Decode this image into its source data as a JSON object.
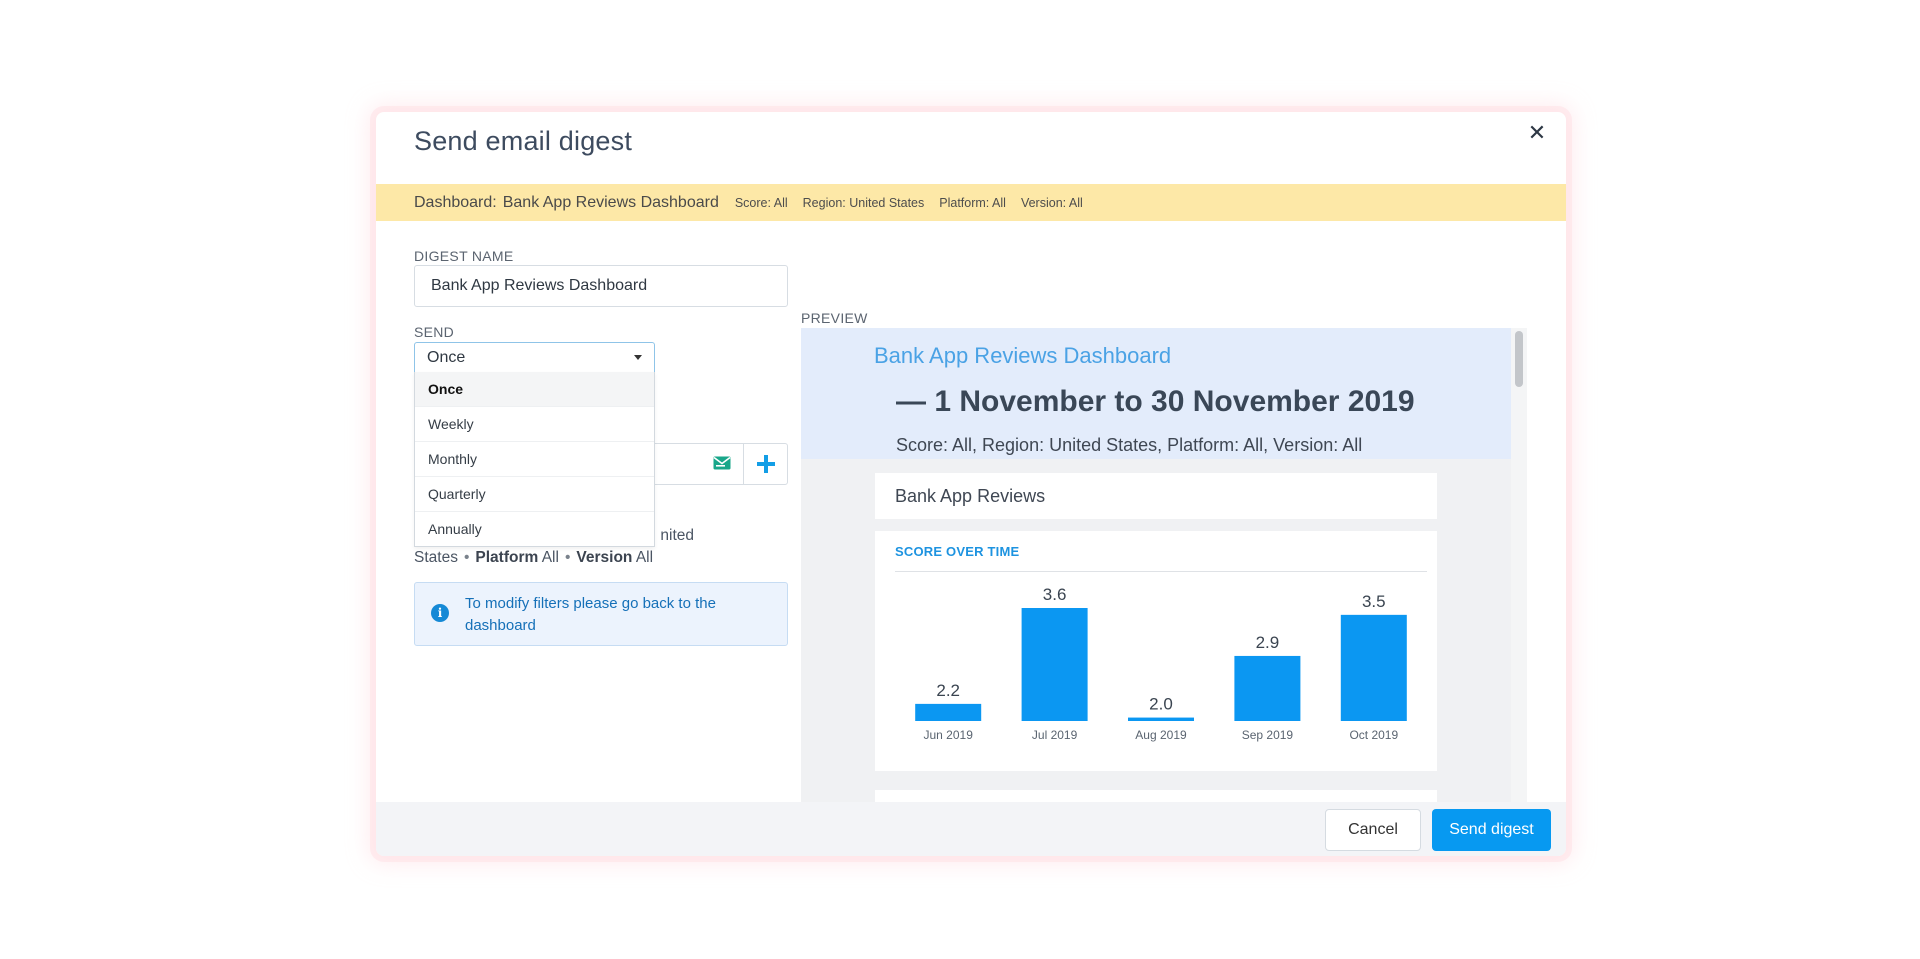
{
  "modal": {
    "title": "Send email digest",
    "close_icon": "close-icon"
  },
  "banner": {
    "dashboard_label": "Dashboard:",
    "dashboard_name": "Bank App Reviews Dashboard",
    "chips": [
      "Score: All",
      "Region: United States",
      "Platform: All",
      "Version: All"
    ],
    "background": "#fde8a7"
  },
  "form": {
    "digest_name_label": "DIGEST NAME",
    "digest_name_value": "Bank App Reviews Dashboard",
    "send_label": "SEND",
    "send_selected": "Once",
    "send_options": [
      "Once",
      "Weekly",
      "Monthly",
      "Quarterly",
      "Annually"
    ],
    "recipient_icon": "email-icon",
    "add_icon": "plus-icon",
    "filters_visible_fragment": "nited",
    "filters_line2": {
      "prefix": "States",
      "platform_key": "Platform",
      "platform_val": "All",
      "version_key": "Version",
      "version_val": "All"
    },
    "info_icon": "info-icon",
    "info_text": "To modify filters please go back to the dashboard"
  },
  "preview": {
    "label": "PREVIEW",
    "dashboard_name": "Bank App Reviews Dashboard",
    "date_range": "— 1 November to 30 November 2019",
    "filters": "Score: All, Region: United States, Platform: All, Version: All",
    "card_title": "Bank App Reviews",
    "chart_heading": "SCORE OVER TIME"
  },
  "chart_data": {
    "type": "bar",
    "title": "SCORE OVER TIME",
    "categories": [
      "Jun 2019",
      "Jul 2019",
      "Aug 2019",
      "Sep 2019",
      "Oct 2019"
    ],
    "values": [
      2.2,
      3.6,
      2.0,
      2.9,
      3.5
    ],
    "value_labels": [
      "2.2",
      "3.6",
      "2.0",
      "2.9",
      "3.5"
    ],
    "ylim": [
      1.95,
      3.6
    ],
    "xlabel": "",
    "ylabel": "",
    "grid": false,
    "color": "#0b97f2"
  },
  "footer": {
    "cancel_label": "Cancel",
    "send_label": "Send digest",
    "accent": "#0799f1"
  }
}
